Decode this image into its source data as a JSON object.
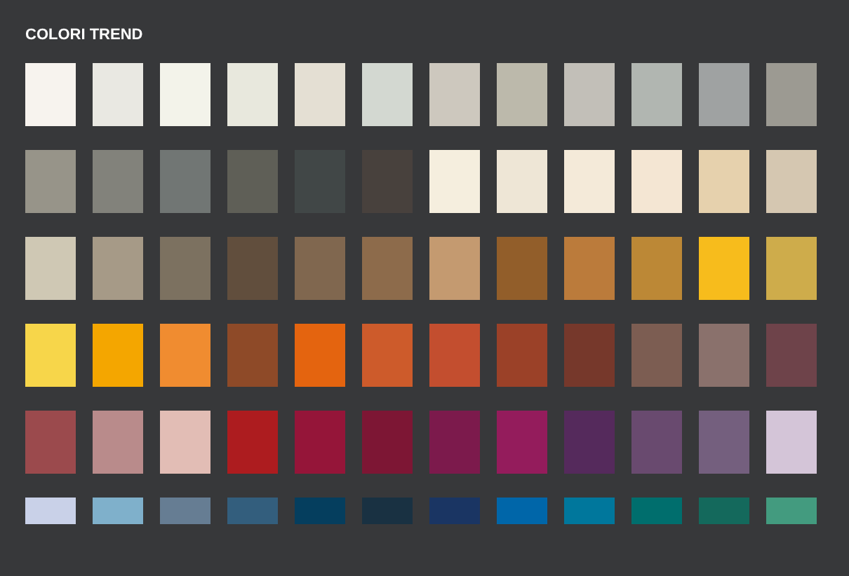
{
  "title": "COLORI TREND",
  "rows": [
    {
      "swatches": [
        {
          "color": "#f7f3ee"
        },
        {
          "color": "#e9e8e2"
        },
        {
          "color": "#f3f3ea"
        },
        {
          "color": "#e8e8dd"
        },
        {
          "color": "#e4dfd3"
        },
        {
          "color": "#d3d8d1"
        },
        {
          "color": "#cdc8be"
        },
        {
          "color": "#bcb9ab"
        },
        {
          "color": "#c2bfb8"
        },
        {
          "color": "#b1b6b1"
        },
        {
          "color": "#9fa2a2"
        },
        {
          "color": "#9c9a92"
        }
      ]
    },
    {
      "swatches": [
        {
          "color": "#979489"
        },
        {
          "color": "#82827b"
        },
        {
          "color": "#717674"
        },
        {
          "color": "#5f5f57"
        },
        {
          "color": "#414747"
        },
        {
          "color": "#48413d"
        },
        {
          "color": "#f5eede"
        },
        {
          "color": "#eee6d6"
        },
        {
          "color": "#f4ead9"
        },
        {
          "color": "#f4e6d3"
        },
        {
          "color": "#e6d1ad"
        },
        {
          "color": "#d5c7b1"
        }
      ]
    },
    {
      "swatches": [
        {
          "color": "#cfc8b4"
        },
        {
          "color": "#a69a87"
        },
        {
          "color": "#7c7160"
        },
        {
          "color": "#614e3d"
        },
        {
          "color": "#80674f"
        },
        {
          "color": "#8d6b4b"
        },
        {
          "color": "#c49a70"
        },
        {
          "color": "#925e2a"
        },
        {
          "color": "#bb7b3b"
        },
        {
          "color": "#bc8836"
        },
        {
          "color": "#f7bc1c"
        },
        {
          "color": "#ceac4b"
        }
      ]
    },
    {
      "swatches": [
        {
          "color": "#f7d64a"
        },
        {
          "color": "#f4a600"
        },
        {
          "color": "#f08c30"
        },
        {
          "color": "#8e4a28"
        },
        {
          "color": "#e4640f"
        },
        {
          "color": "#cd5b2b"
        },
        {
          "color": "#c34e2f"
        },
        {
          "color": "#9b4128"
        },
        {
          "color": "#76382b"
        },
        {
          "color": "#7c5d52"
        },
        {
          "color": "#8a716c"
        },
        {
          "color": "#6e434a"
        }
      ]
    },
    {
      "swatches": [
        {
          "color": "#9b4a4d"
        },
        {
          "color": "#b98b8b"
        },
        {
          "color": "#e2bdb5"
        },
        {
          "color": "#ad1c1f"
        },
        {
          "color": "#951539"
        },
        {
          "color": "#7d1634"
        },
        {
          "color": "#7c1a4c"
        },
        {
          "color": "#941c5c"
        },
        {
          "color": "#552a5c"
        },
        {
          "color": "#694a6f"
        },
        {
          "color": "#745f7e"
        },
        {
          "color": "#d4c5d8"
        }
      ]
    },
    {
      "swatches": [
        {
          "color": "#c9d1e8"
        },
        {
          "color": "#7fb0cb"
        },
        {
          "color": "#667d93"
        },
        {
          "color": "#335e7d"
        },
        {
          "color": "#053e5e"
        },
        {
          "color": "#193142"
        },
        {
          "color": "#1a3563"
        },
        {
          "color": "#0066a9"
        },
        {
          "color": "#00779c"
        },
        {
          "color": "#006e6d"
        },
        {
          "color": "#14695c"
        },
        {
          "color": "#439b7f"
        }
      ]
    }
  ]
}
